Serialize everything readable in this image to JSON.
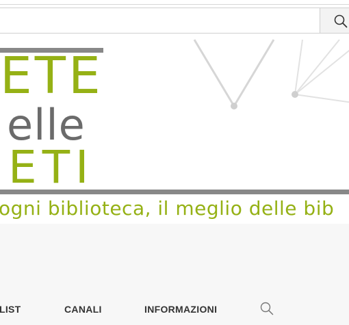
{
  "header": {
    "search_placeholder": "",
    "search_icon": "search-icon"
  },
  "banner": {
    "logo_line1": "ETE",
    "logo_line2": "elle",
    "logo_line3": "ETI",
    "tagline": "ogni biblioteca, il meglio delle bib",
    "colors": {
      "green": "#95b115",
      "gray": "#888888",
      "text_gray": "#6b6b6b"
    }
  },
  "nav": {
    "items": [
      {
        "label": "LIST"
      },
      {
        "label": "CANALI"
      },
      {
        "label": "INFORMAZIONI"
      }
    ],
    "search_icon": "search-icon"
  }
}
